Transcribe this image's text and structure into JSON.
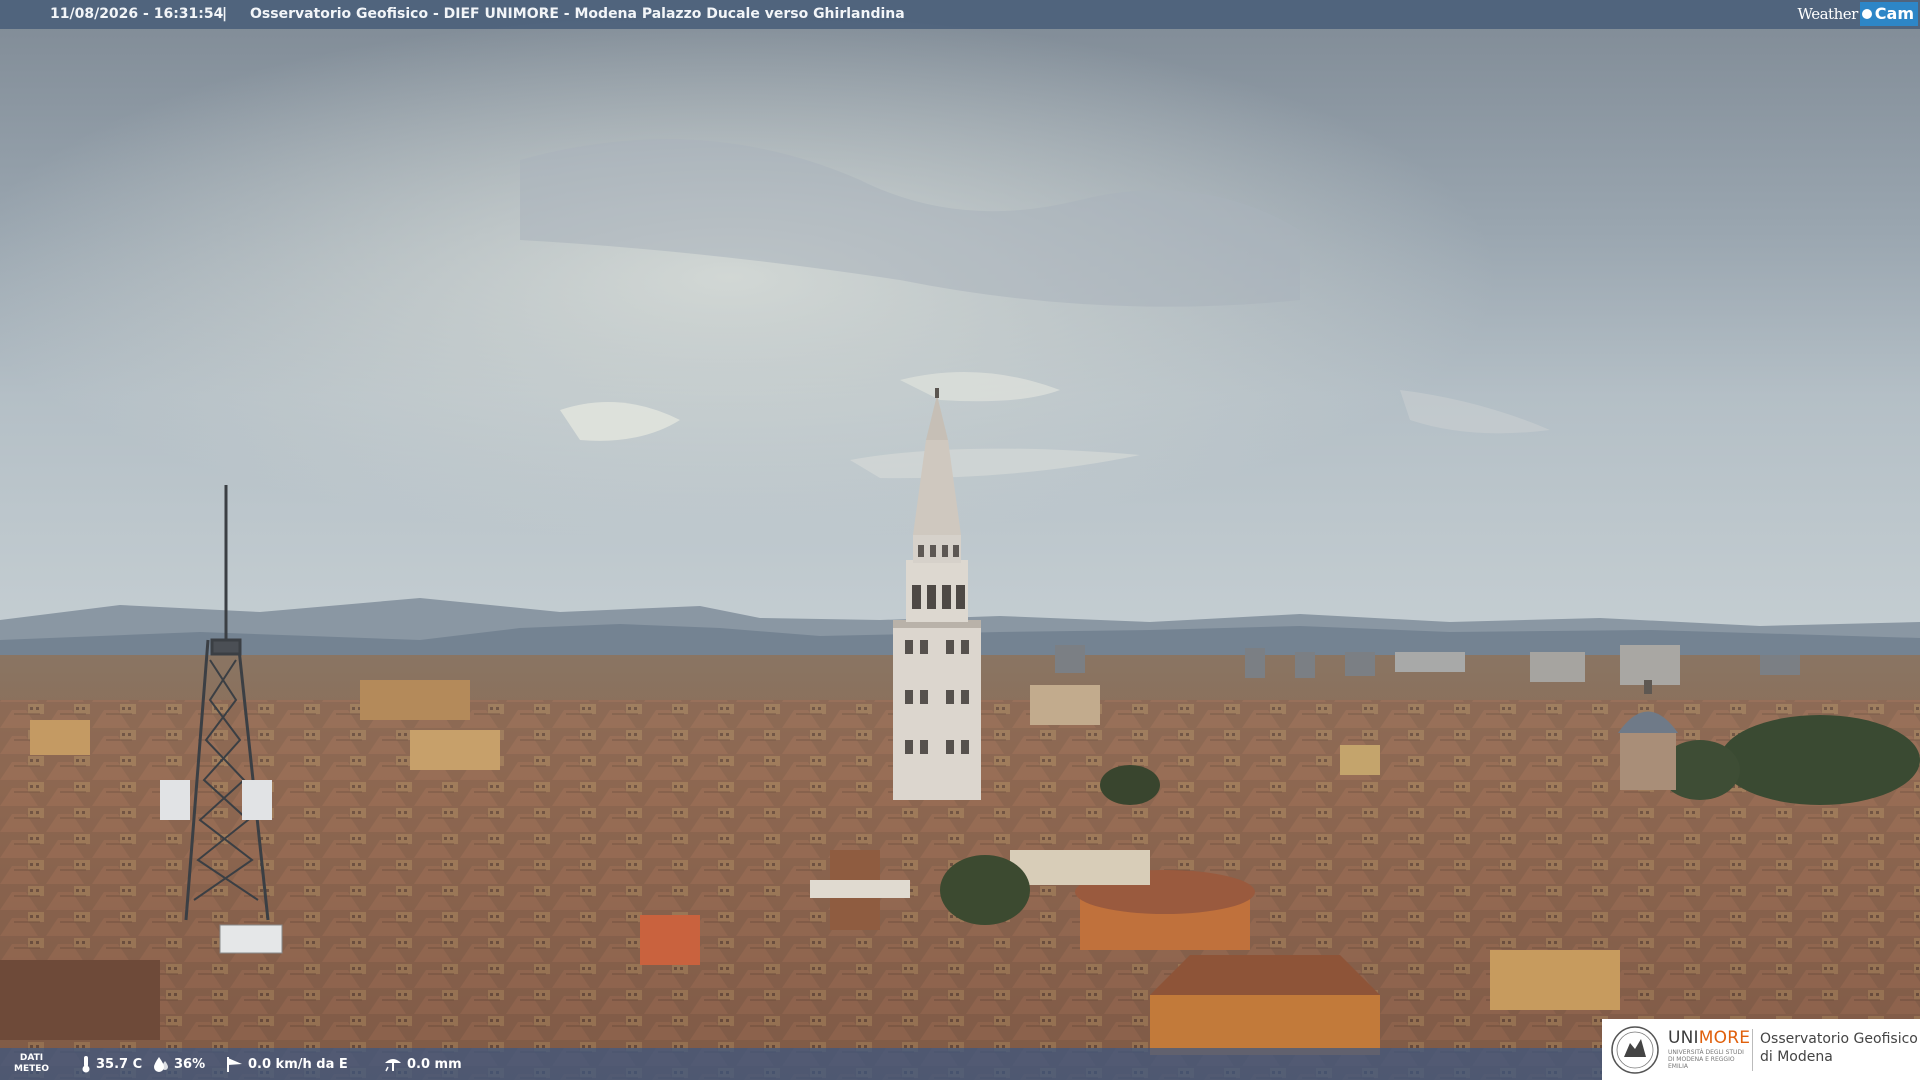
{
  "caption": {
    "timestamp": "11/08/2026 - 16:31:54",
    "separator": "|",
    "title": "Osservatorio Geofisico - DIEF UNIMORE - Modena Palazzo Ducale verso Ghirlandina",
    "logo_left": "Weather",
    "logo_right": "Cam"
  },
  "weather": {
    "label_line1": "DATI",
    "label_line2": "METEO",
    "temperature": "35.7 C",
    "humidity": "36%",
    "wind": "0.0 km/h da E",
    "rain": "0.0 mm",
    "icons": [
      "thermometer-icon",
      "humidity-drop-icon",
      "wind-vane-icon",
      "rain-gauge-icon"
    ]
  },
  "institution": {
    "brand_part1": "UNI",
    "brand_part2": "MORE",
    "brand_sub": "UNIVERSITÀ DEGLI STUDI DI MODENA E REGGIO EMILIA",
    "observatory_line1": "Osservatorio Geofisico",
    "observatory_line2": "di Modena"
  },
  "colors": {
    "caption_bar": "#465c78",
    "weather_bar": "#3c5882",
    "brand_orange": "#e0600c",
    "logo_blue": "#2d86c7"
  }
}
